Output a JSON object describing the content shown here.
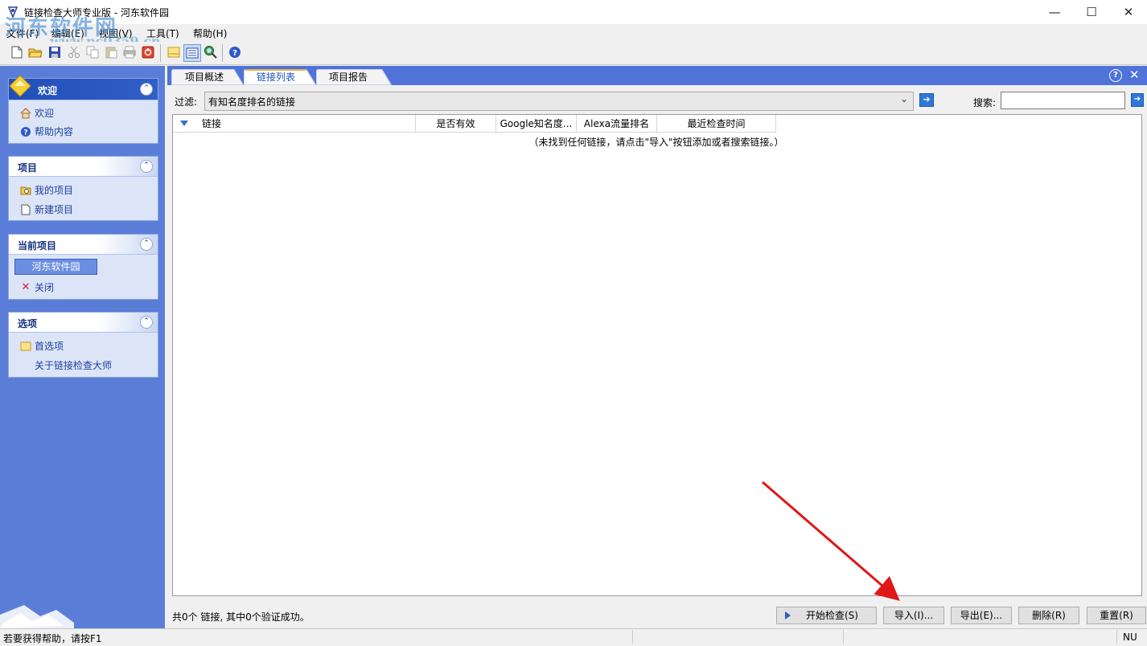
{
  "window": {
    "title": "链接检查大师专业版 - 河东软件园",
    "watermark_text": "河东软件网",
    "watermark_url": "www.pc0359.cn",
    "minimize_glyph": "—",
    "maximize_glyph": "☐",
    "close_glyph": "✕"
  },
  "menu": {
    "file": "文件(F)",
    "edit": "编辑(E)",
    "view": "视图(V)",
    "tools": "工具(T)",
    "help": "帮助(H)"
  },
  "toolbar": {
    "icons": [
      "new-icon",
      "open-icon",
      "save-icon",
      "cut-icon",
      "copy-icon",
      "paste-icon",
      "print-icon",
      "stop-icon",
      "note-icon",
      "detail-view-icon",
      "search-web-icon",
      "help-icon"
    ]
  },
  "sidebar": {
    "groups": [
      {
        "title": "欢迎",
        "items": [
          {
            "label": "欢迎",
            "icon": "home-icon"
          },
          {
            "label": "帮助内容",
            "icon": "help-icon"
          }
        ]
      },
      {
        "title": "项目",
        "items": [
          {
            "label": "我的项目",
            "icon": "folder-search-icon"
          },
          {
            "label": "新建项目",
            "icon": "new-document-icon"
          }
        ]
      },
      {
        "title": "当前项目",
        "items": [
          {
            "label": "河东软件园",
            "icon": ""
          },
          {
            "label": "关闭",
            "icon": "close-red-icon"
          }
        ]
      },
      {
        "title": "选项",
        "items": [
          {
            "label": "首选项",
            "icon": "preferences-icon"
          },
          {
            "label": "关于链接检查大师",
            "icon": ""
          }
        ]
      }
    ]
  },
  "tabs": [
    {
      "label": "项目概述",
      "active": false
    },
    {
      "label": "链接列表",
      "active": true
    },
    {
      "label": "项目报告",
      "active": false
    }
  ],
  "filter": {
    "label": "过滤:",
    "value": "有知名度排名的链接",
    "go_glyph": "➔"
  },
  "search": {
    "label": "搜索:",
    "value": "",
    "go_glyph": "➔"
  },
  "list": {
    "columns": [
      "链接",
      "是否有效",
      "Google知名度...",
      "Alexa流量排名",
      "最近检查时间"
    ],
    "empty_message": "（未找到任何链接，请点击\"导入\"按钮添加或者搜索链接。）"
  },
  "footer": {
    "summary": "共0个 链接, 其中0个验证成功。",
    "buttons": {
      "start": "开始检查(S)",
      "import": "导入(I)...",
      "export": "导出(E)...",
      "delete": "删除(R)",
      "reset": "重置(R)"
    }
  },
  "statusbar": {
    "text": "若要获得帮助，请按F1",
    "num": "NU"
  },
  "colors": {
    "sidebar_bg": "#5a7ed8",
    "tab_strip": "#4f73d9",
    "annotation_arrow": "#e01818"
  }
}
